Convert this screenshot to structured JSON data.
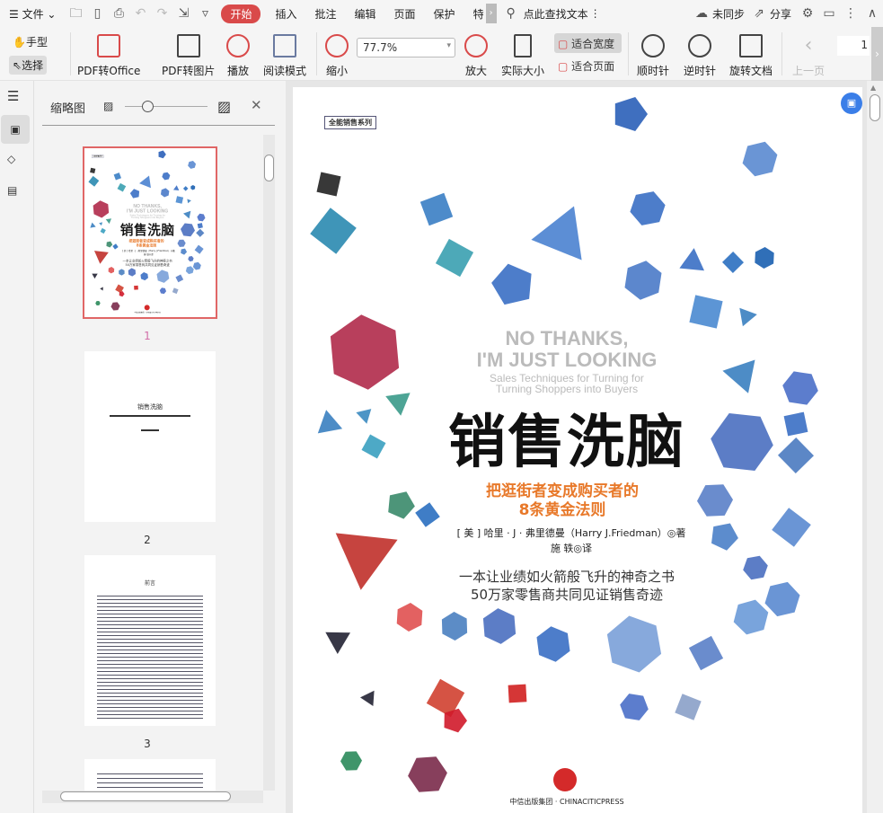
{
  "menubar": {
    "file": "文件",
    "start": "开始",
    "tabs": [
      "插入",
      "批注",
      "编辑",
      "页面",
      "保护",
      "特"
    ],
    "search": "点此查找文本",
    "sync": "未同步",
    "share": "分享"
  },
  "toolbar": {
    "hand": "手型",
    "select": "选择",
    "pdf_office": "PDF转Office",
    "pdf_image": "PDF转图片",
    "play": "播放",
    "read_mode": "阅读模式",
    "zoom_out": "缩小",
    "zoom_value": "77.7%",
    "zoom_in": "放大",
    "actual_size": "实际大小",
    "fit_width": "适合宽度",
    "fit_page": "适合页面",
    "clockwise": "顺时针",
    "counterclockwise": "逆时针",
    "rotate_doc": "旋转文档",
    "prev_page": "上一页",
    "page_number": "1"
  },
  "panel": {
    "title": "缩略图",
    "thumbnails": [
      {
        "label": "1",
        "selected": true
      },
      {
        "label": "2"
      },
      {
        "label": "3"
      }
    ],
    "page2_title": "销售洗脑",
    "page3_title": "前言"
  },
  "cover": {
    "series": "全能销售系列",
    "en_title1": "NO THANKS,",
    "en_title2": "I'M JUST LOOKING",
    "en_sub1": "Sales Techniques for Turning for",
    "en_sub2": "Turning Shoppers into Buyers",
    "title": "销售洗脑",
    "subtitle1": "把逛街者变成购买者的",
    "subtitle2": "8条黄金法则",
    "author": "[ 美 ] 哈里 · J · 弗里德曼（Harry J.Friedman）◎著",
    "translator": "施 轶◎译",
    "tagline1": "一本让业绩如火箭般飞升的神奇之书",
    "tagline2": "50万家零售商共同见证销售奇迹",
    "publisher": "中信出版集团 · CHINACITICPRESS"
  },
  "colors": {
    "accent": "#d94a4a",
    "orange": "#e8792a",
    "blue": "#3a6fc4"
  }
}
